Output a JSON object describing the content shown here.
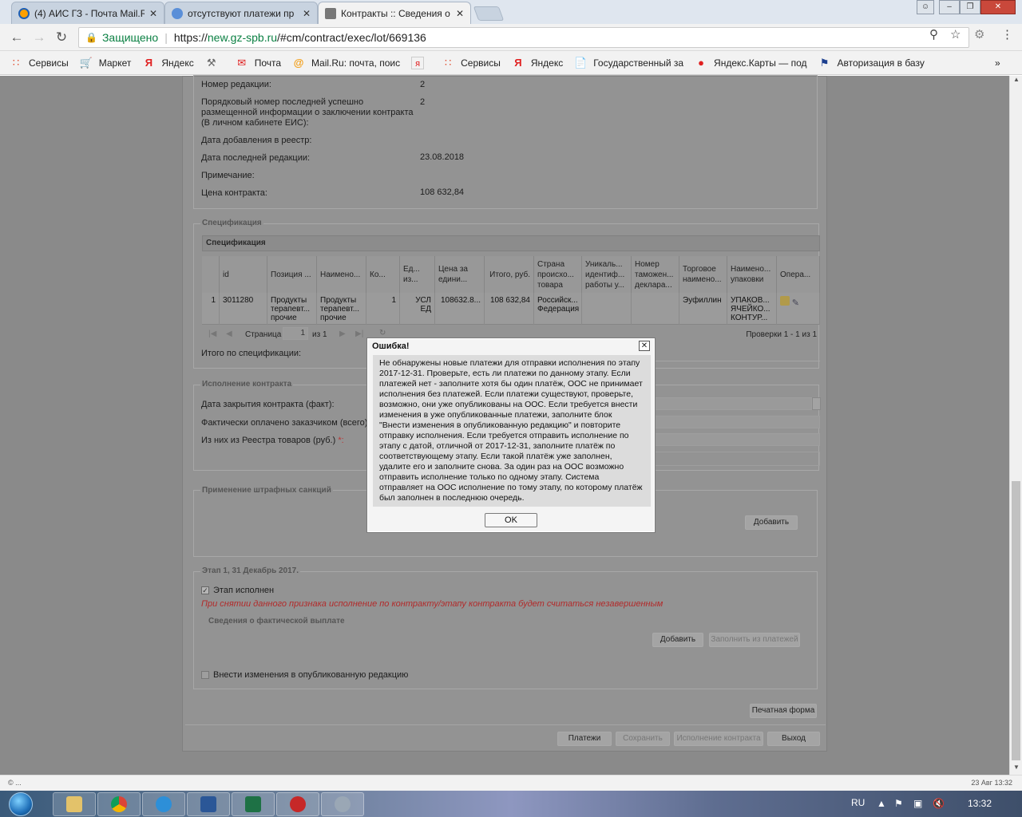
{
  "browser": {
    "tabs": [
      {
        "label": "(4) АИС ГЗ - Почта Mail.R",
        "close": "✕"
      },
      {
        "label": "отсутствуют платежи пр",
        "close": "✕"
      },
      {
        "label": "Контракты :: Сведения о",
        "close": "✕"
      }
    ],
    "address": {
      "secure_label": "Защищено",
      "url_scheme": "https://",
      "url_host": "new.gz-spb.ru",
      "url_path": "/#cm/contract/exec/lot/669136"
    },
    "bookmarks": [
      {
        "label": "Сервисы",
        "icon": "apps-grid-icon"
      },
      {
        "label": "Маркет",
        "icon": "cart-icon"
      },
      {
        "label": "Яндекс",
        "icon": "yandex-icon"
      },
      {
        "label": "",
        "icon": "tool-icon"
      },
      {
        "label": "Почта",
        "icon": "mail-envelope-icon"
      },
      {
        "label": "Mail.Ru: почта, поис",
        "icon": "mailru-at-icon"
      },
      {
        "label": "",
        "icon": "yandex-square-icon"
      },
      {
        "label": "Сервисы",
        "icon": "apps-grid-icon"
      },
      {
        "label": "Яндекс",
        "icon": "yandex-icon"
      },
      {
        "label": "Государственный за",
        "icon": "document-icon"
      },
      {
        "label": "Яндекс.Карты — под",
        "icon": "map-pin-icon"
      },
      {
        "label": "Авторизация в базу",
        "icon": "flag-icon"
      }
    ],
    "bookmarks_more": "»"
  },
  "contract": {
    "fields": {
      "edition_number_label": "Номер редакции:",
      "edition_number_value": "2",
      "serial_label": "Порядковый номер последней успешно размещенной информации о заключении контракта (В личном кабинете ЕИС):",
      "serial_value": "2",
      "date_added_label": "Дата добавления в реестр:",
      "date_last_edit_label": "Дата последней редакции:",
      "date_last_edit_value": "23.08.2018",
      "note_label": "Примечание:",
      "price_label": "Цена контракта:",
      "price_value": "108 632,84"
    },
    "spec": {
      "legend": "Спецификация",
      "caption": "Спецификация",
      "columns": [
        "id",
        "Позиция ...",
        "Наимено...",
        "Ко...",
        "Ед... из...",
        "Цена за едини...",
        "Итого, руб.",
        "Страна происхо... товара",
        "Уникаль... идентиф... работы у...",
        "Номер таможен... деклара...",
        "Торговое наимено...",
        "Наимено... упаковки",
        "Опера..."
      ],
      "row": {
        "num": "1",
        "id": "3011280",
        "position": "Продукты терапевт... прочие",
        "name": "Продукты терапевт... прочие",
        "qty": "1",
        "unit": "УСЛ ЕД",
        "price": "108632.8...",
        "total": "108 632,84",
        "country": "Российск... Федерация",
        "trade_name": "Эуфиллин",
        "package": "УПАКОВ... ЯЧЕЙКО... КОНТУР..."
      },
      "pager": {
        "page_label": "Страница",
        "page_value": "1",
        "of_label": "из 1",
        "records": "Проверки 1 - 1 из 1"
      },
      "total_label": "Итого по спецификации:"
    },
    "execution": {
      "legend": "Исполнение контракта",
      "close_date_label": "Дата закрытия контракта (факт):",
      "paid_label": "Фактически оплачено заказчиком (всего)",
      "registry_label": "Из них из Реестра товаров (руб.)",
      "required_mark": "*:"
    },
    "penalties": {
      "legend": "Применение штрафных санкций",
      "add_button": "Добавить"
    },
    "stage": {
      "legend": "Этап 1, 31 Декабрь 2017.",
      "done_label": "Этап исполнен",
      "warning": "При снятии данного признака исполнение по контракту/этапу контракта будет считаться незавершенным",
      "payment_legend": "Сведения о фактической выплате",
      "add_button": "Добавить",
      "fill_button": "Заполнить из платежей",
      "amend_label": "Внести изменения в опубликованную редакцию"
    },
    "print_button": "Печатная форма",
    "footer_buttons": {
      "payments": "Платежи",
      "save": "Сохранить",
      "execute": "Исполнение контракта",
      "exit": "Выход"
    }
  },
  "dialog": {
    "title": "Ошибка!",
    "close": "✕",
    "message": "Не обнаружены новые платежи для отправки исполнения по этапу 2017-12-31. Проверьте, есть ли платежи по данному этапу. Если платежей нет - заполните хотя бы один платёж, ООС не принимает исполнения без платежей. Если платежи существуют, проверьте, возможно, они уже опубликованы на ООС. Если требуется внести изменения в уже опубликованные платежи, заполните блок \"Внести изменения в опубликованную редакцию\" и повторите отправку исполнения. Если требуется отправить исполнение по этапу с датой, отличной от 2017-12-31, заполните платёж по соответствующему этапу. Если такой платёж уже заполнен, удалите его и заполните снова. За один раз на ООС возможно отправить исполнение только по одному этапу. Система отправляет на ООС исполнение по тому этапу, по которому платёж был заполнен в последнюю очередь.",
    "ok": "OK"
  },
  "status": {
    "left": "© ...",
    "right": "23 Авг 13:32"
  },
  "taskbar": {
    "lang": "RU",
    "time": "13:32"
  }
}
